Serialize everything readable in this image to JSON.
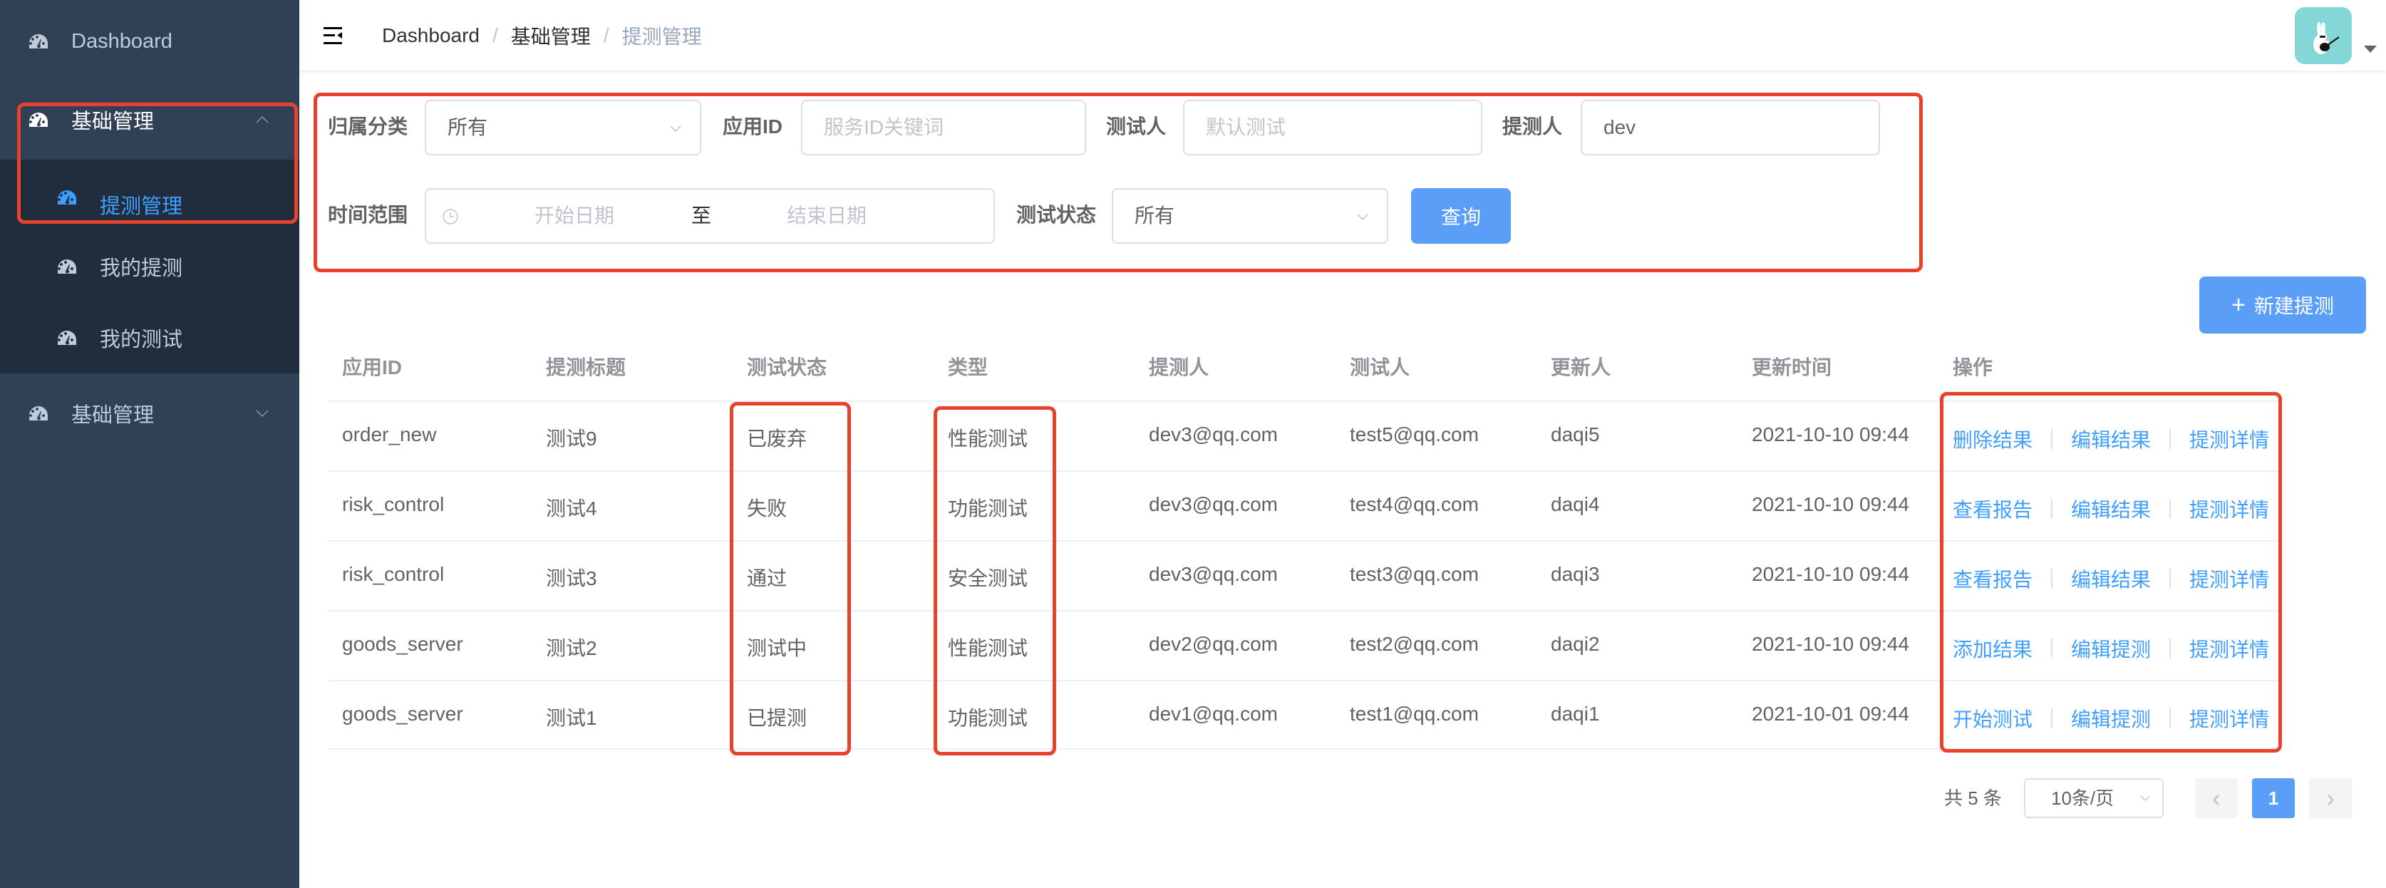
{
  "sidebar": {
    "items": [
      {
        "label": "Dashboard",
        "icon": "dashboard-gauge-icon"
      },
      {
        "label": "基础管理",
        "icon": "dashboard-gauge-icon",
        "expanded": true,
        "children": [
          {
            "label": "提测管理",
            "active": true
          },
          {
            "label": "我的提测"
          },
          {
            "label": "我的测试"
          }
        ]
      },
      {
        "label": "基础管理",
        "icon": "dashboard-gauge-icon",
        "expanded": false
      }
    ]
  },
  "navbar": {
    "breadcrumb": [
      "Dashboard",
      "基础管理",
      "提测管理"
    ],
    "separator": "/"
  },
  "filters": {
    "category": {
      "label": "归属分类",
      "value": "所有"
    },
    "app_id": {
      "label": "应用ID",
      "placeholder": "服务ID关键词"
    },
    "tester": {
      "label": "测试人",
      "placeholder": "默认测试"
    },
    "submitter": {
      "label": "提测人",
      "value": "dev"
    },
    "time_range": {
      "label": "时间范围",
      "start_placeholder": "开始日期",
      "separator": "至",
      "end_placeholder": "结束日期"
    },
    "status": {
      "label": "测试状态",
      "value": "所有"
    },
    "query_button": "查询"
  },
  "new_button": {
    "icon": "+",
    "label": "新建提测"
  },
  "table": {
    "columns": [
      "应用ID",
      "提测标题",
      "测试状态",
      "类型",
      "提测人",
      "测试人",
      "更新人",
      "更新时间",
      "操作"
    ],
    "rows": [
      {
        "app_id": "order_new",
        "title": "测试9",
        "status": "已废弃",
        "type": "性能测试",
        "submitter": "dev3@qq.com",
        "tester": "test5@qq.com",
        "updater": "daqi5",
        "updated": "2021-10-10 09:44",
        "ops": [
          "删除结果",
          "编辑结果",
          "提测详情"
        ]
      },
      {
        "app_id": "risk_control",
        "title": "测试4",
        "status": "失败",
        "type": "功能测试",
        "submitter": "dev3@qq.com",
        "tester": "test4@qq.com",
        "updater": "daqi4",
        "updated": "2021-10-10 09:44",
        "ops": [
          "查看报告",
          "编辑结果",
          "提测详情"
        ]
      },
      {
        "app_id": "risk_control",
        "title": "测试3",
        "status": "通过",
        "type": "安全测试",
        "submitter": "dev3@qq.com",
        "tester": "test3@qq.com",
        "updater": "daqi3",
        "updated": "2021-10-10 09:44",
        "ops": [
          "查看报告",
          "编辑结果",
          "提测详情"
        ]
      },
      {
        "app_id": "goods_server",
        "title": "测试2",
        "status": "测试中",
        "type": "性能测试",
        "submitter": "dev2@qq.com",
        "tester": "test2@qq.com",
        "updater": "daqi2",
        "updated": "2021-10-10 09:44",
        "ops": [
          "添加结果",
          "编辑提测",
          "提测详情"
        ]
      },
      {
        "app_id": "goods_server",
        "title": "测试1",
        "status": "已提测",
        "type": "功能测试",
        "submitter": "dev1@qq.com",
        "tester": "test1@qq.com",
        "updater": "daqi1",
        "updated": "2021-10-01 09:44",
        "ops": [
          "开始测试",
          "编辑提测",
          "提测详情"
        ]
      }
    ]
  },
  "pagination": {
    "total": "共 5 条",
    "page_size": "10条/页",
    "prev": "‹",
    "current_page": "1",
    "next": "›"
  },
  "colors": {
    "sidebar_bg": "#304156",
    "submenu_bg": "#1f2d3d",
    "primary": "#409eff",
    "button_bg": "#5a9ef8",
    "highlight": "#e8412c"
  }
}
